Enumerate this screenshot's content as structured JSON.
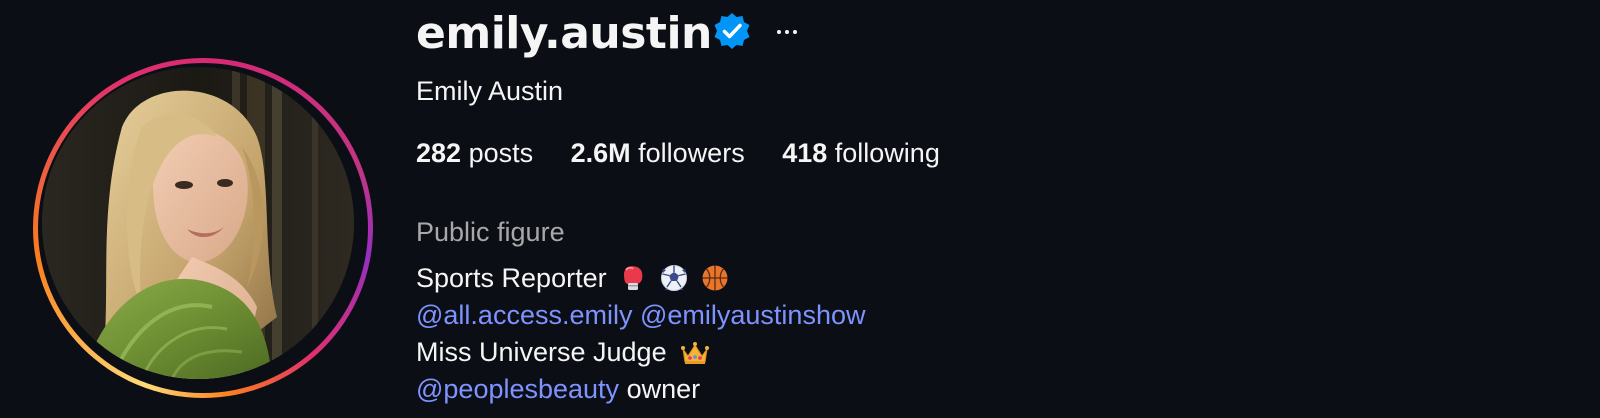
{
  "profile": {
    "username": "emily.austin",
    "full_name": "Emily Austin",
    "verified_icon": "verified-badge-icon",
    "more_icon": "more-options-icon",
    "avatar_icon": "profile-photo"
  },
  "stats": {
    "posts_count": "282",
    "posts_label": " posts",
    "followers_count": "2.6M",
    "followers_label": " followers",
    "following_count": "418",
    "following_label": " following"
  },
  "bio": {
    "category": "Public figure",
    "line1_text": "Sports Reporter",
    "line1_emojis": [
      "boxing-glove-icon",
      "soccer-ball-icon",
      "basketball-icon"
    ],
    "line2_mention1": "@all.access.emily",
    "line2_mention2": "@emilyaustinshow",
    "line3_text": "Miss Universe Judge",
    "line3_emoji": "crown-icon",
    "line4_mention": "@peoplesbeauty",
    "line4_text": " owner"
  },
  "colors": {
    "background": "#0b0e14",
    "text": "#f5f5f5",
    "muted": "#a8a8a8",
    "link": "#7e93ff",
    "verified": "#0095f6"
  }
}
